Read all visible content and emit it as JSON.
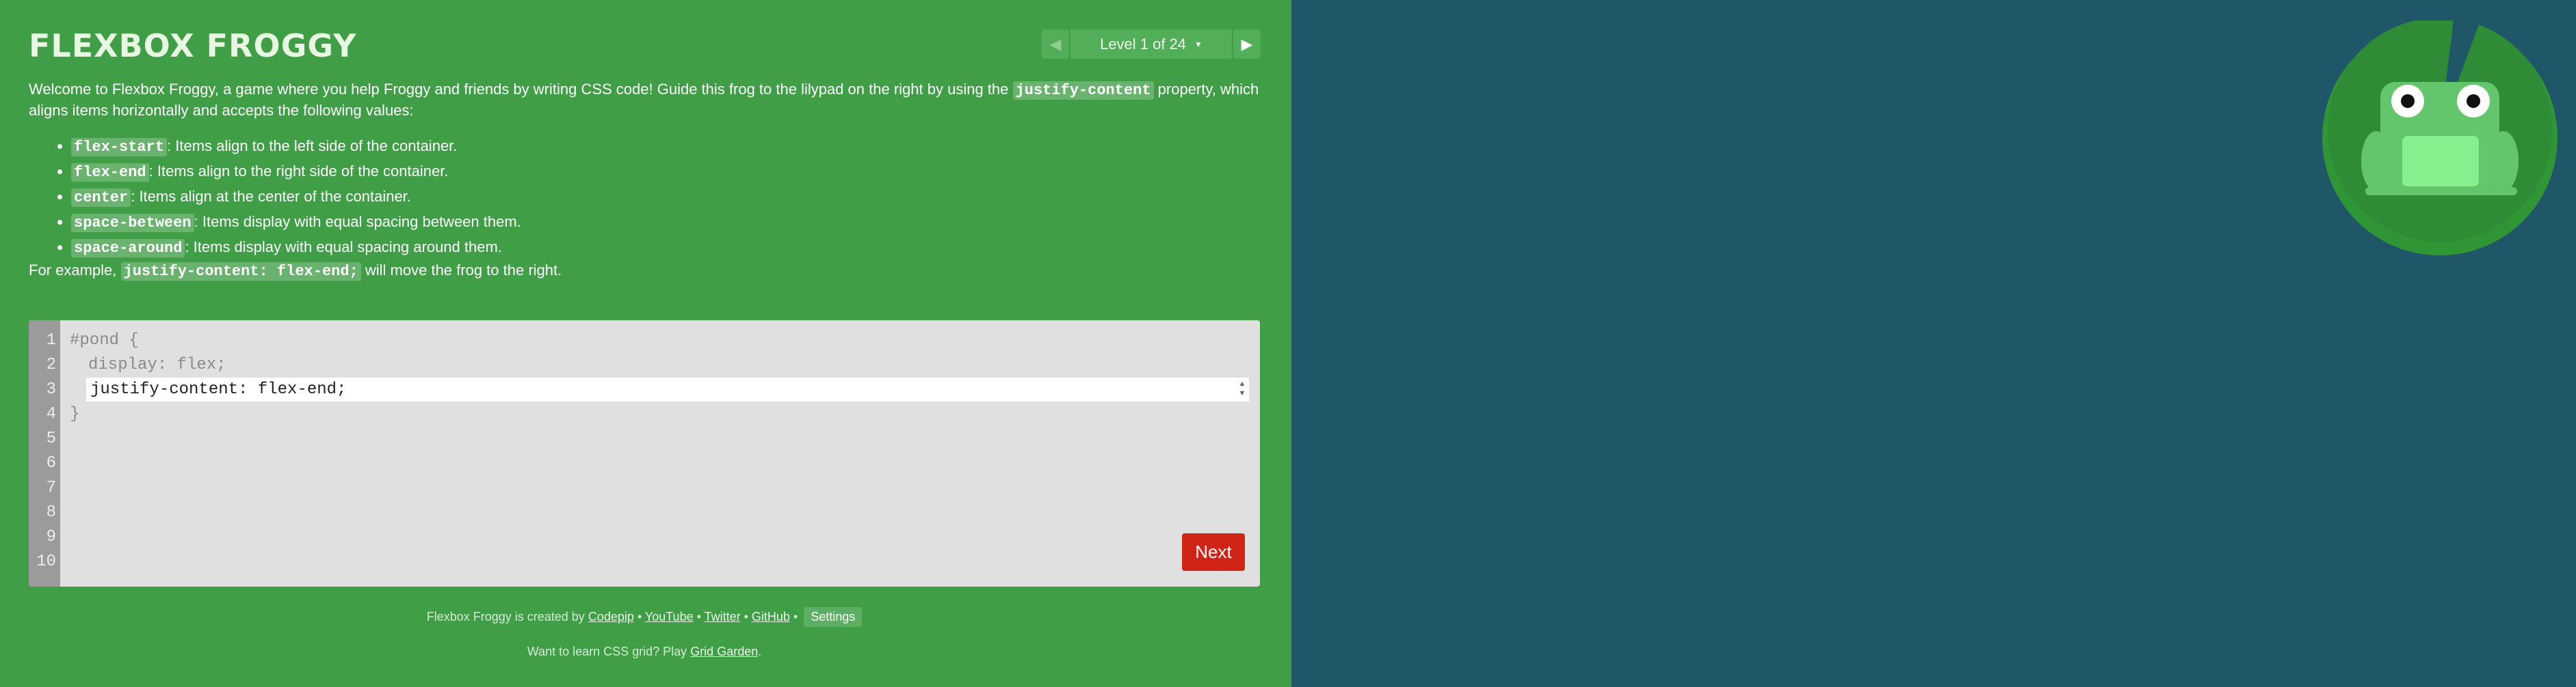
{
  "header": {
    "title": "FLEXBOX FROGGY",
    "level_label": "Level 1 of 24",
    "prev_icon": "◀",
    "next_icon": "▶",
    "caret": "▼"
  },
  "instructions": {
    "intro_before": "Welcome to Flexbox Froggy, a game where you help Froggy and friends by writing CSS code! Guide this frog to the lilypad on the right by using the ",
    "intro_code": "justify-content",
    "intro_after": " property, which aligns items horizontally and accepts the following values:",
    "values": [
      {
        "code": "flex-start",
        "text": ": Items align to the left side of the container."
      },
      {
        "code": "flex-end",
        "text": ": Items align to the right side of the container."
      },
      {
        "code": "center",
        "text": ": Items align at the center of the container."
      },
      {
        "code": "space-between",
        "text": ": Items display with equal spacing between them."
      },
      {
        "code": "space-around",
        "text": ": Items display with equal spacing around them."
      }
    ],
    "example_before": "For example, ",
    "example_code": "justify-content: flex-end;",
    "example_after": " will move the frog to the right."
  },
  "editor": {
    "line_numbers": [
      "1",
      "2",
      "3",
      "4",
      "5",
      "6",
      "7",
      "8",
      "9",
      "10"
    ],
    "line1": "#pond {",
    "line2": "display: flex;",
    "input_value": "justify-content: flex-end;",
    "line4": "}",
    "stepper_up": "▲",
    "stepper_down": "▼",
    "next_label": "Next"
  },
  "footer": {
    "created_by": "Flexbox Froggy is created by ",
    "links": [
      "Codepip",
      "YouTube",
      "Twitter",
      "GitHub"
    ],
    "separator": " • ",
    "settings_label": "Settings",
    "grid_prefix": "Want to learn CSS grid? Play ",
    "grid_link": "Grid Garden",
    "grid_suffix": "."
  },
  "colors": {
    "sidebar_bg": "#409e47",
    "pond_bg": "#1f5768",
    "lilypad": "#2e8b36",
    "frog": "#63c66d",
    "next_button": "#cf2416"
  }
}
